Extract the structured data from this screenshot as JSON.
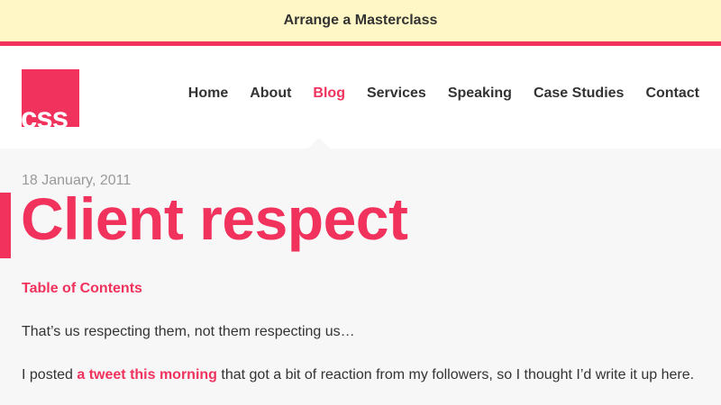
{
  "promo": {
    "label": "Arrange a Masterclass"
  },
  "logo": {
    "text": "css"
  },
  "nav": {
    "items": [
      {
        "label": "Home"
      },
      {
        "label": "About"
      },
      {
        "label": "Blog"
      },
      {
        "label": "Services"
      },
      {
        "label": "Speaking"
      },
      {
        "label": "Case Studies"
      },
      {
        "label": "Contact"
      }
    ],
    "active": "Blog"
  },
  "post": {
    "date": "18 January, 2011",
    "title": "Client respect",
    "toc_label": "Table of Contents",
    "intro": "That’s us respecting them, not them respecting us…",
    "body_before_link": "I posted ",
    "body_link": "a tweet this morning",
    "body_after_link": " that got a bit of reaction from my followers, so I thought I’d write it up here."
  },
  "colors": {
    "accent": "#f0325d",
    "promo_bg": "#fff8c6",
    "text": "#333333",
    "muted": "#999999"
  }
}
